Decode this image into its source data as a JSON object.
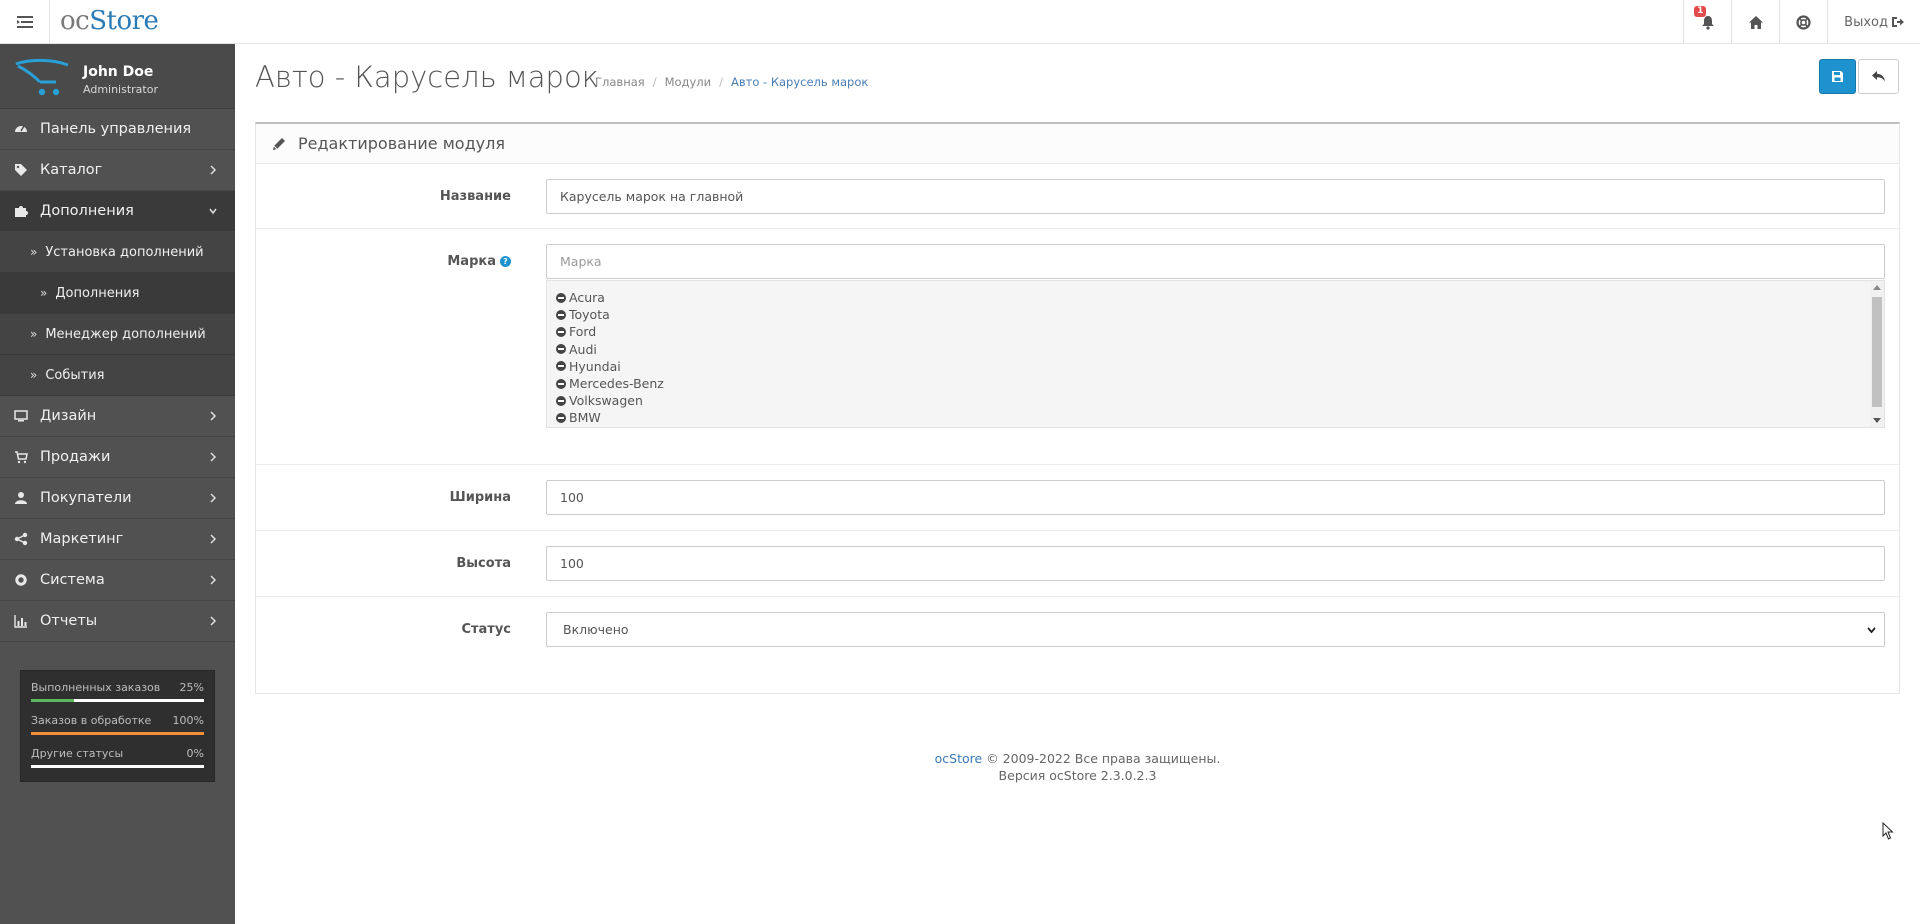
{
  "header": {
    "logo_oc": "oc",
    "logo_store": "Store",
    "notification_count": "1",
    "logout_label": "Выход"
  },
  "profile": {
    "name": "John Doe",
    "role": "Administrator"
  },
  "sidebar": {
    "items": [
      {
        "label": "Панель управления",
        "icon": "dashboard-icon"
      },
      {
        "label": "Каталог",
        "icon": "tags-icon"
      },
      {
        "label": "Дополнения",
        "icon": "puzzle-icon"
      },
      {
        "label": "Установка дополнений"
      },
      {
        "label": "Дополнения"
      },
      {
        "label": "Менеджер дополнений"
      },
      {
        "label": "События"
      },
      {
        "label": "Дизайн",
        "icon": "desktop-icon"
      },
      {
        "label": "Продажи",
        "icon": "cart-icon"
      },
      {
        "label": "Покупатели",
        "icon": "user-icon"
      },
      {
        "label": "Маркетинг",
        "icon": "share-icon"
      },
      {
        "label": "Система",
        "icon": "cog-icon"
      },
      {
        "label": "Отчеты",
        "icon": "bar-chart-icon"
      }
    ]
  },
  "stats": [
    {
      "label": "Выполненных заказов",
      "value": "25%",
      "percent": 25,
      "color": "#5cb85c"
    },
    {
      "label": "Заказов в обработке",
      "value": "100%",
      "percent": 100,
      "color": "#f0913a"
    },
    {
      "label": "Другие статусы",
      "value": "0%",
      "percent": 0,
      "color": "#d9534f"
    }
  ],
  "page": {
    "title": "Авто - Карусель марок",
    "breadcrumb": [
      "Главная",
      "Модули",
      "Авто - Карусель марок"
    ]
  },
  "panel": {
    "heading": "Редактирование модуля"
  },
  "form": {
    "name_label": "Название",
    "name_value": "Карусель марок на главной",
    "brand_label": "Марка",
    "brand_placeholder": "Марка",
    "brands": [
      "Acura",
      "Toyota",
      "Ford",
      "Audi",
      "Hyundai",
      "Mercedes-Benz",
      "Volkswagen",
      "BMW"
    ],
    "width_label": "Ширина",
    "width_value": "100",
    "height_label": "Высота",
    "height_value": "100",
    "status_label": "Статус",
    "status_value": "Включено"
  },
  "footer": {
    "brand": "ocStore",
    "copyright": " © 2009-2022 Все права защищены.",
    "version": "Версия ocStore 2.3.0.2.3"
  },
  "colors": {
    "sidebar_bg": "#515151",
    "primary": "#1e91cf",
    "link": "#3b7ab8"
  }
}
